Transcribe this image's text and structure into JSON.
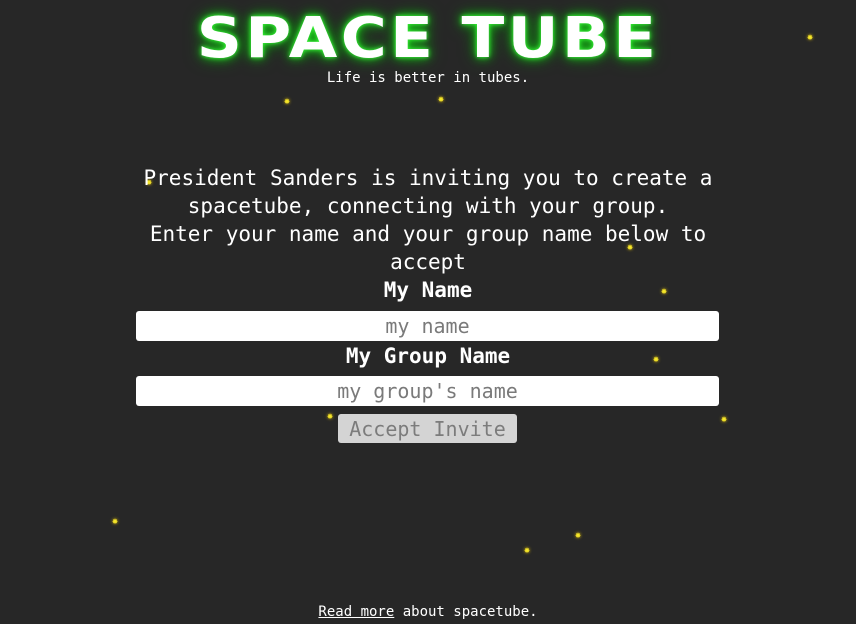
{
  "header": {
    "title": "SPACE TUBE",
    "tagline": "Life is better in tubes."
  },
  "invite": {
    "line1": "President Sanders is inviting you to create a spacetube, connecting with your group.",
    "line2": "Enter your name and your group name below to accept"
  },
  "form": {
    "name_label": "My Name",
    "name_value": "",
    "name_placeholder": "my name",
    "group_label": "My Group Name",
    "group_value": "",
    "group_placeholder": "my group's name",
    "submit_label": "Accept Invite"
  },
  "footer": {
    "link_text": "Read more",
    "rest_text": " about spacetube."
  },
  "colors": {
    "background": "#272727",
    "title_glow": "#1fd11f",
    "star": "#f5e62a",
    "button_bg": "#d4d4d4",
    "button_text": "#7c7c7c"
  },
  "icons": {
    "star": "star-icon"
  }
}
